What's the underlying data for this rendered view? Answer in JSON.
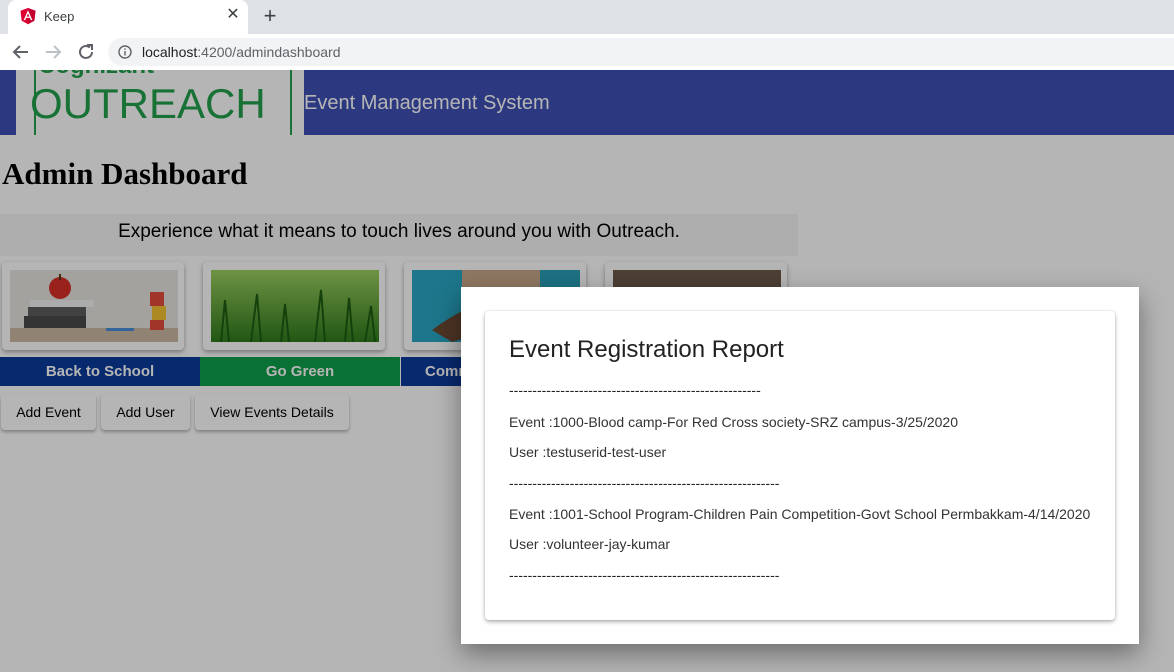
{
  "browser": {
    "tab_title": "Keep",
    "url_host": "localhost",
    "url_path": ":4200/admindashboard"
  },
  "header": {
    "logo_top": "Cognizant",
    "logo_main": "OUTREACH",
    "app_title": "Event Management System"
  },
  "page_title": "Admin Dashboard",
  "tagline": "Experience what it means to touch lives around you with Outreach.",
  "categories": [
    {
      "label": "Back to School",
      "color": "#0b3a9b"
    },
    {
      "label": "Go Green",
      "color": "#0ea049"
    },
    {
      "label": "Comm",
      "color": "#0b3a9b"
    }
  ],
  "buttons": {
    "add_event": "Add Event",
    "add_user": "Add User",
    "view_events": "View Events Details"
  },
  "dialog": {
    "title": "Event Registration Report",
    "separator1": "------------------------------------------------------",
    "event1": "Event :1000-Blood camp-For Red Cross society-SRZ campus-3/25/2020",
    "user1": "User :testuserid-test-user",
    "separator2": "----------------------------------------------------------",
    "event2": "Event :1001-School Program-Children Pain Competition-Govt School Permbakkam-4/14/2020",
    "user2": "User :volunteer-jay-kumar",
    "separator3": "----------------------------------------------------------"
  },
  "colors": {
    "navbar": "#3f51b5",
    "logo_green": "#22a04b"
  }
}
